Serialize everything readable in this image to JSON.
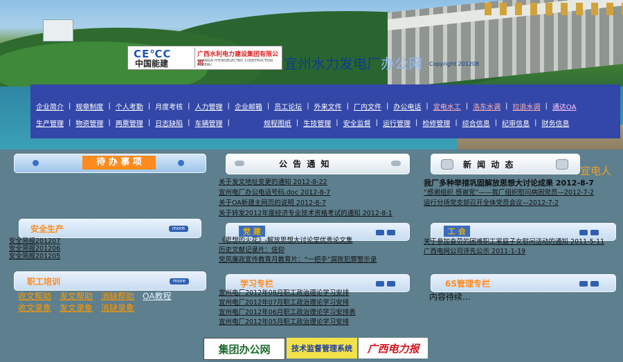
{
  "header": {
    "logo_cepc": "CE℃C",
    "logo_cn": "中国能建",
    "logo_sub": "广西水利电力建设集团有限公司",
    "logo_sub_en": "GUANGXI HYDROELECTRIC CONSTRUCTION BUREAU",
    "site_title_main": "宜州水力发电厂",
    "site_title_oa": "办公网",
    "copyright": "Copyright 201208"
  },
  "nav": {
    "row1": [
      {
        "label": "企业简介",
        "style": "normal"
      },
      {
        "label": "规章制度",
        "style": "normal"
      },
      {
        "label": "个人考勤",
        "style": "normal"
      },
      {
        "label": "月度考核",
        "style": "plain"
      },
      {
        "label": "人力管理",
        "style": "normal"
      },
      {
        "label": "企业邮箱",
        "style": "normal"
      },
      {
        "label": "员工论坛",
        "style": "normal"
      },
      {
        "label": "外来文件",
        "style": "normal"
      },
      {
        "label": "厂内文件",
        "style": "normal"
      },
      {
        "label": "办公电话",
        "style": "normal"
      },
      {
        "label": "宜电水工",
        "style": "red"
      },
      {
        "label": "洛东水调",
        "style": "red"
      },
      {
        "label": "拉浪水调",
        "style": "red"
      },
      {
        "label": "通达OA",
        "style": "pink"
      }
    ],
    "row2_left": [
      {
        "label": "生产管理",
        "style": "normal"
      },
      {
        "label": "物资管理",
        "style": "normal"
      },
      {
        "label": "两票管理",
        "style": "normal"
      },
      {
        "label": "日志缺陷",
        "style": "normal"
      },
      {
        "label": "车辆管理",
        "style": "normal"
      }
    ],
    "row2_right": [
      {
        "label": "规程图纸",
        "style": "normal"
      },
      {
        "label": "生技管理",
        "style": "normal"
      },
      {
        "label": "安全监督",
        "style": "normal"
      },
      {
        "label": "运行管理",
        "style": "normal"
      },
      {
        "label": "检修管理",
        "style": "normal"
      },
      {
        "label": "综合信息",
        "style": "normal"
      },
      {
        "label": "纪审信息",
        "style": "normal"
      },
      {
        "label": "财务信息",
        "style": "normal"
      }
    ]
  },
  "panels": {
    "todo": {
      "title": "待 办 事 项"
    },
    "notice": {
      "title": "公 告 通 知",
      "items": [
        "关于发文地址变更的通知 2012-8-22",
        "宜州电厂办公电话号码.doc 2012-8-7",
        "关于OA新建主网页的说明 2012-8-7",
        "关于转发2012年度经济专业技术资格考试的通知 2012-8-1"
      ]
    },
    "news": {
      "title": "新 闻 动 态",
      "side_label": "宜电人",
      "headline": "我厂多种举措巩固解放思想大讨论成果  2012-8-7",
      "items": [
        "“感谢组织 感谢党”——我厂组织慰问病困党员—2012-7-2",
        "运行分场党支部召开全体党员会议—2012-7-2"
      ]
    },
    "safety": {
      "title": "安全生产",
      "more": "more",
      "items": [
        "安全简报201207",
        "安全简报201206",
        "安全简报201205"
      ]
    },
    "party": {
      "title": "党 建",
      "items": [
        "《思想的火花》-解放思想大讨论堂优秀论文集",
        "历史文献记录片：信仰",
        "党风廉政宣传教育月教育片：“一把手”腐败犯罪警示录"
      ]
    },
    "union": {
      "title": "工 会",
      "items": [
        "关于参加奋劳的困难职工家庭子女慰问活动的通知 2011-5-11",
        "广西电网公司评先公示 2011-1-19"
      ]
    },
    "training": {
      "title": "职工培训",
      "more": "more",
      "links_row1": [
        "收文帮助",
        "发文帮助",
        "消缺帮助",
        "OA教程"
      ],
      "links_row2": [
        "收文录象",
        "发文录象",
        "消缺录象"
      ]
    },
    "study": {
      "title": "学习专栏",
      "items": [
        "宜州电厂2012年08月职工政治理论学习安排",
        "宜州电厂2012年07月职工政治理论学习安排",
        "宜州电厂2012年06月职工政治理论学习安排表",
        "宜州电厂2012年05月职工政治理论学习安排"
      ]
    },
    "sixs": {
      "title": "6S管理专栏",
      "content": "内容待续…"
    }
  },
  "footer": {
    "badge1": "集团办公网",
    "badge2": "技术监督管理系统",
    "badge3": "广西电力报"
  },
  "colors": {
    "page_bg": "#5d7f8e",
    "nav_bg": "#3347a8",
    "accent_orange": "#ff8a1e",
    "title_blue": "#0c3d8f"
  }
}
